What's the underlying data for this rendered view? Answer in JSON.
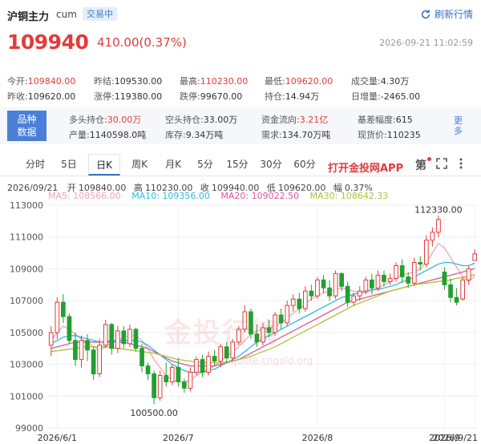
{
  "header": {
    "title": "沪铜主力",
    "code": "cum",
    "status": "交易中",
    "refresh_label": "刷新行情"
  },
  "quote": {
    "price": "109940",
    "change": "410.00(0.37%)",
    "datetime": "2026-09-21 11:02:59"
  },
  "stats": [
    {
      "label": "今开:",
      "value": "109840.00",
      "tone": "red"
    },
    {
      "label": "昨结:",
      "value": "109530.00",
      "tone": ""
    },
    {
      "label": "最高:",
      "value": "110230.00",
      "tone": "red"
    },
    {
      "label": "最低:",
      "value": "109620.00",
      "tone": "red"
    },
    {
      "label": "成交量:",
      "value": "4.30万",
      "tone": ""
    },
    {
      "label": "昨收:",
      "value": "109620.00",
      "tone": ""
    },
    {
      "label": "涨停:",
      "value": "119380.00",
      "tone": ""
    },
    {
      "label": "跌停:",
      "value": "99670.00",
      "tone": ""
    },
    {
      "label": "持仓:",
      "value": "14.94万",
      "tone": ""
    },
    {
      "label": "日增量:",
      "value": "-2465.00",
      "tone": ""
    }
  ],
  "species": {
    "tag_line1": "品种",
    "tag_line2": "数据",
    "items": [
      {
        "label": "多头持仓:",
        "value": "30.00万",
        "tone": "red"
      },
      {
        "label": "空头持仓:",
        "value": "33.00万",
        "tone": ""
      },
      {
        "label": "资金流向:",
        "value": "3.21亿",
        "tone": "red"
      },
      {
        "label": "基差幅度:",
        "value": "615",
        "tone": ""
      },
      {
        "label": "产量:",
        "value": "1140598.0吨",
        "tone": ""
      },
      {
        "label": "库存:",
        "value": "9.34万吨",
        "tone": ""
      },
      {
        "label": "需求:",
        "value": "134.70万吨",
        "tone": ""
      },
      {
        "label": "现货价:",
        "value": "110235",
        "tone": ""
      }
    ],
    "more_label": "更多"
  },
  "tabs": [
    "分时",
    "5日",
    "日K",
    "周K",
    "月K",
    "5分",
    "15分",
    "30分",
    "60分"
  ],
  "active_tab": 2,
  "app_link": "打开金投网APP",
  "tools": {
    "brush": "第"
  },
  "ohlc": {
    "date": "2026/09/21",
    "open_label": "开",
    "open": "109840.00",
    "high_label": "高",
    "high": "110230.00",
    "close_label": "收",
    "close": "109940.00",
    "low_label": "低",
    "low": "109620.00",
    "amp_label": "幅",
    "amp": "0.37%"
  },
  "ma": [
    {
      "label": "MA5: 108566.00",
      "color": "#f5a3b8"
    },
    {
      "label": "MA10: 109356.00",
      "color": "#2bbde0"
    },
    {
      "label": "MA20: 109022.50",
      "color": "#e0559a"
    },
    {
      "label": "MA30: 108642.33",
      "color": "#a9c43b"
    }
  ],
  "watermark": {
    "text": "金投行情",
    "url": "quote.cngold.org"
  },
  "colors": {
    "up": "#e23b3b",
    "down": "#22a02e",
    "accent": "#3d6fc2"
  },
  "chart_data": {
    "type": "candlestick",
    "y_ticks": [
      "113000",
      "111000",
      "109000",
      "107000",
      "105000",
      "103000",
      "101000",
      "99000"
    ],
    "ylim": [
      99000,
      113000
    ],
    "x_ticks": [
      "2026/6/1",
      "2026/7",
      "2026/8",
      "2026/9",
      "2026/9/21"
    ],
    "annotations": [
      {
        "text": "112330.00",
        "value": 112330
      },
      {
        "text": "100500.00",
        "value": 100500
      }
    ],
    "candles": [
      [
        104200,
        105400,
        103500,
        105000
      ],
      [
        105000,
        107200,
        104600,
        106900
      ],
      [
        106900,
        107400,
        105600,
        106000
      ],
      [
        106000,
        106200,
        104300,
        104500
      ],
      [
        104500,
        105000,
        102900,
        103300
      ],
      [
        103300,
        104800,
        102800,
        104500
      ],
      [
        104500,
        104900,
        103200,
        103900
      ],
      [
        103900,
        104100,
        102000,
        102400
      ],
      [
        102400,
        104600,
        102200,
        104200
      ],
      [
        104200,
        105800,
        104000,
        105500
      ],
      [
        105500,
        105600,
        103600,
        104000
      ],
      [
        104000,
        105400,
        103700,
        105100
      ],
      [
        105100,
        105400,
        104000,
        104300
      ],
      [
        104300,
        105500,
        104100,
        105200
      ],
      [
        105200,
        105300,
        103800,
        104000
      ],
      [
        104000,
        104300,
        102500,
        102900
      ],
      [
        102900,
        103100,
        102000,
        102400
      ],
      [
        102400,
        102600,
        100500,
        100900
      ],
      [
        100900,
        102600,
        100700,
        102300
      ],
      [
        102300,
        103100,
        101600,
        101900
      ],
      [
        101900,
        103000,
        101700,
        102800
      ],
      [
        102800,
        103400,
        101600,
        101900
      ],
      [
        101900,
        102100,
        101200,
        101500
      ],
      [
        101500,
        102800,
        101300,
        102500
      ],
      [
        102500,
        103500,
        102300,
        103300
      ],
      [
        103300,
        103600,
        102200,
        102500
      ],
      [
        102500,
        103800,
        102300,
        103500
      ],
      [
        103500,
        103900,
        102900,
        103200
      ],
      [
        103200,
        104300,
        102800,
        104100
      ],
      [
        104100,
        104400,
        103100,
        103400
      ],
      [
        103400,
        104600,
        103200,
        104400
      ],
      [
        104400,
        105400,
        104200,
        105200
      ],
      [
        105200,
        106700,
        105000,
        106300
      ],
      [
        106300,
        106500,
        104600,
        104900
      ],
      [
        104900,
        105500,
        104100,
        104400
      ],
      [
        104400,
        105600,
        104200,
        105300
      ],
      [
        105300,
        105800,
        104700,
        105000
      ],
      [
        105000,
        106300,
        104800,
        106100
      ],
      [
        106100,
        106500,
        105200,
        105600
      ],
      [
        105600,
        107000,
        105400,
        106700
      ],
      [
        106700,
        107400,
        106300,
        107100
      ],
      [
        107100,
        107500,
        106200,
        106500
      ],
      [
        106500,
        107900,
        106300,
        107600
      ],
      [
        107600,
        108000,
        107000,
        107300
      ],
      [
        107300,
        108500,
        107100,
        108300
      ],
      [
        108300,
        108600,
        107500,
        107800
      ],
      [
        107800,
        108300,
        107000,
        107300
      ],
      [
        107300,
        108900,
        107100,
        108700
      ],
      [
        108700,
        108800,
        107600,
        107900
      ],
      [
        107900,
        108200,
        106600,
        106900
      ],
      [
        106900,
        107500,
        106700,
        107300
      ],
      [
        107300,
        107900,
        107000,
        107600
      ],
      [
        107600,
        108500,
        107400,
        108300
      ],
      [
        108300,
        108700,
        107400,
        107800
      ],
      [
        107800,
        108900,
        107600,
        108600
      ],
      [
        108600,
        108900,
        107900,
        108200
      ],
      [
        108200,
        108700,
        108000,
        108400
      ],
      [
        108400,
        109400,
        108200,
        109200
      ],
      [
        109200,
        109600,
        108100,
        108500
      ],
      [
        108500,
        108800,
        107800,
        108100
      ],
      [
        108100,
        109700,
        107900,
        109400
      ],
      [
        109400,
        109800,
        108900,
        109300
      ],
      [
        109300,
        111100,
        109100,
        110800
      ],
      [
        110800,
        111600,
        110400,
        111300
      ],
      [
        111300,
        112330,
        111000,
        112100
      ],
      [
        108800,
        109100,
        107700,
        108000
      ],
      [
        108000,
        108400,
        106900,
        107200
      ],
      [
        107200,
        107800,
        106700,
        106900
      ],
      [
        107100,
        108500,
        107000,
        108300
      ],
      [
        108300,
        109200,
        108000,
        109000
      ],
      [
        109530,
        110230,
        109620,
        109940
      ]
    ],
    "ma_lines": {
      "MA5": [
        104500,
        105000,
        105400,
        105200,
        104900,
        104600,
        104400,
        104100,
        103900,
        104100,
        104400,
        104500,
        104700,
        104800,
        104800,
        104500,
        104000,
        103300,
        102800,
        102300,
        102000,
        101900,
        101900,
        102000,
        102300,
        102500,
        102700,
        102900,
        103200,
        103500,
        103800,
        104100,
        104500,
        104900,
        105100,
        105200,
        105300,
        105400,
        105600,
        105900,
        106200,
        106500,
        106800,
        107100,
        107300,
        107500,
        107600,
        107700,
        107800,
        107700,
        107600,
        107500,
        107500,
        107600,
        107800,
        108000,
        108200,
        108400,
        108600,
        108700,
        108800,
        109000,
        109400,
        110000,
        110600,
        110300,
        109700,
        109100,
        108500,
        108200,
        108566
      ],
      "MA10": [
        104300,
        104500,
        104700,
        104800,
        104800,
        104700,
        104600,
        104500,
        104400,
        104400,
        104500,
        104500,
        104500,
        104500,
        104500,
        104400,
        104200,
        103900,
        103600,
        103300,
        103000,
        102800,
        102600,
        102500,
        102500,
        102500,
        102600,
        102700,
        102900,
        103100,
        103300,
        103500,
        103800,
        104100,
        104400,
        104600,
        104800,
        105000,
        105200,
        105400,
        105600,
        105800,
        106000,
        106200,
        106400,
        106600,
        106800,
        107000,
        107200,
        107300,
        107400,
        107500,
        107600,
        107700,
        107700,
        107800,
        107900,
        108000,
        108200,
        108300,
        108500,
        108700,
        108900,
        109100,
        109300,
        109400,
        109400,
        109300,
        109200,
        109200,
        109356
      ],
      "MA20": [
        104000,
        104100,
        104200,
        104300,
        104400,
        104400,
        104400,
        104400,
        104400,
        104400,
        104400,
        104400,
        104400,
        104300,
        104200,
        104100,
        104000,
        103800,
        103600,
        103400,
        103200,
        103100,
        103000,
        102900,
        102900,
        102900,
        102900,
        102900,
        103000,
        103100,
        103200,
        103300,
        103500,
        103700,
        103900,
        104100,
        104300,
        104500,
        104700,
        104900,
        105100,
        105300,
        105500,
        105700,
        105900,
        106100,
        106300,
        106500,
        106700,
        106900,
        107000,
        107100,
        107200,
        107300,
        107400,
        107500,
        107600,
        107700,
        107800,
        107900,
        108000,
        108100,
        108200,
        108300,
        108400,
        108500,
        108600,
        108700,
        108800,
        108900,
        109022.5
      ],
      "MA30": [
        103800,
        103850,
        103900,
        103950,
        104000,
        104050,
        104100,
        104100,
        104100,
        104100,
        104050,
        104000,
        103950,
        103900,
        103850,
        103800,
        103750,
        103700,
        103600,
        103500,
        103400,
        103300,
        103250,
        103200,
        103150,
        103100,
        103100,
        103100,
        103100,
        103150,
        103200,
        103300,
        103400,
        103500,
        103650,
        103800,
        103950,
        104100,
        104300,
        104500,
        104700,
        104900,
        105100,
        105300,
        105500,
        105700,
        105900,
        106100,
        106300,
        106500,
        106700,
        106850,
        107000,
        107150,
        107300,
        107450,
        107600,
        107700,
        107800,
        107900,
        108000,
        108050,
        108100,
        108150,
        108200,
        108250,
        108300,
        108400,
        108450,
        108550,
        108642.33
      ]
    }
  }
}
